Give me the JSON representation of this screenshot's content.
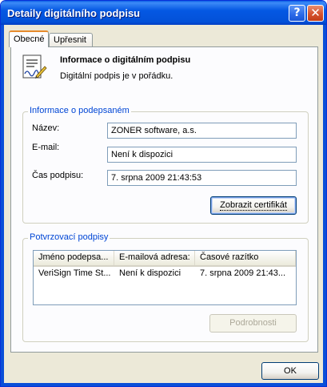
{
  "window": {
    "title": "Detaily digitálního podpisu"
  },
  "tabs": [
    {
      "label": "Obecné",
      "active": true
    },
    {
      "label": "Upřesnit",
      "active": false
    }
  ],
  "info": {
    "title": "Informace o digitálním podpisu",
    "status": "Digitální podpis je v pořádku."
  },
  "signer": {
    "legend": "Informace o podepsaném",
    "name_label": "Název:",
    "name_value": "ZONER software, a.s.",
    "email_label": "E-mail:",
    "email_value": "Není k dispozici",
    "time_label": "Čas podpisu:",
    "time_value": "7. srpna 2009 21:43:53",
    "cert_button": "Zobrazit certifikát"
  },
  "countersig": {
    "legend": "Potvrzovací podpisy",
    "columns": [
      "Jméno podepsa...",
      "E-mailová adresa:",
      "Časové razítko"
    ],
    "rows": [
      [
        "VeriSign Time St...",
        "Není k dispozici",
        "7. srpna 2009 21:43..."
      ]
    ],
    "details_button": "Podrobnosti"
  },
  "ok_button": "OK",
  "colors": {
    "titlebar": "#0458e3",
    "group_legend": "#0046d5",
    "window_bg": "#ece9d8"
  }
}
